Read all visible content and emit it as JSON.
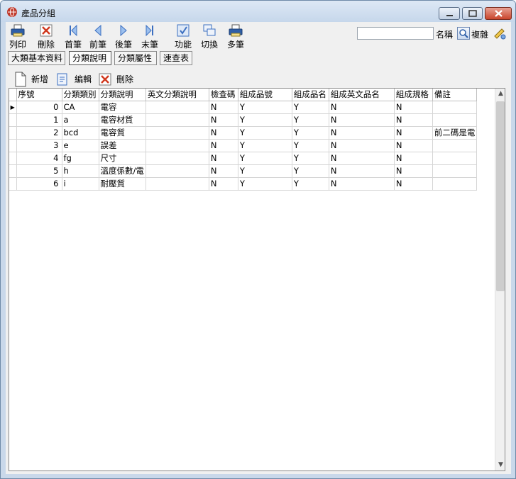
{
  "window": {
    "title": "產品分組"
  },
  "toolbar": {
    "print_label": "列印",
    "delete_label": "刪除",
    "first_label": "首筆",
    "prev_label": "前筆",
    "next_label": "後筆",
    "last_label": "末筆",
    "function_label": "功能",
    "switch_label": "切換",
    "multi_label": "多筆"
  },
  "search": {
    "value": "",
    "name_label": "名稱",
    "copy_label": "複雜"
  },
  "tabs": [
    {
      "label": "大類基本資料"
    },
    {
      "label": "分類說明"
    },
    {
      "label": "分類屬性"
    },
    {
      "label": "速查表"
    }
  ],
  "actions": {
    "add_label": "新增",
    "edit_label": "編輯",
    "delete_label": "刪除"
  },
  "grid": {
    "columns": [
      "序號",
      "分類類別",
      "分類說明",
      "英文分類說明",
      "檢查碼",
      "組成品號",
      "組成品名",
      "組成英文品名",
      "組成規格",
      "備註"
    ],
    "rows": [
      [
        "0",
        "CA",
        "電容",
        "",
        "N",
        "Y",
        "Y",
        "N",
        "N",
        ""
      ],
      [
        "1",
        "a",
        "電容材質",
        "",
        "N",
        "Y",
        "Y",
        "N",
        "N",
        ""
      ],
      [
        "2",
        "bcd",
        "電容質",
        "",
        "N",
        "Y",
        "Y",
        "N",
        "N",
        "前二碼是電"
      ],
      [
        "3",
        "e",
        "誤差",
        "",
        "N",
        "Y",
        "Y",
        "N",
        "N",
        ""
      ],
      [
        "4",
        "fg",
        "尺寸",
        "",
        "N",
        "Y",
        "Y",
        "N",
        "N",
        ""
      ],
      [
        "5",
        "h",
        "溫度係數/電",
        "",
        "N",
        "Y",
        "Y",
        "N",
        "N",
        ""
      ],
      [
        "6",
        "i",
        "耐壓質",
        "",
        "N",
        "Y",
        "Y",
        "N",
        "N",
        ""
      ]
    ]
  },
  "colors": {
    "titlebar": "#c6d7eb",
    "close": "#c9452c",
    "client": "#f0f0f0"
  }
}
